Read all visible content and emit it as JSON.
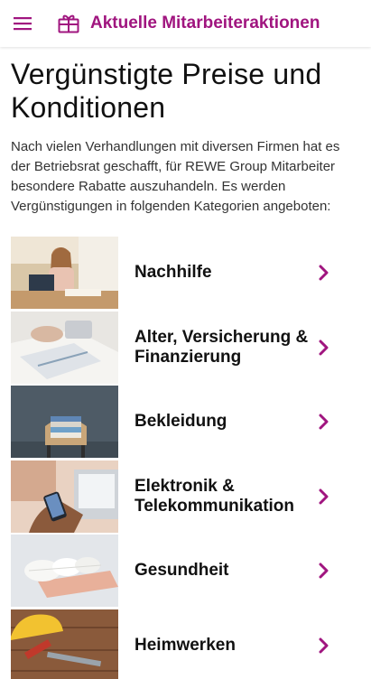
{
  "colors": {
    "accent": "#a0157f"
  },
  "appbar": {
    "menu_icon": "hamburger-menu-icon",
    "title_icon": "gift-icon",
    "title": "Aktuelle Mitarbeiteraktionen"
  },
  "page": {
    "title": "Vergünstigte Preise und Konditionen",
    "intro": "Nach vielen Verhandlungen mit diversen Firmen hat es der Betriebsrat geschafft, für REWE Group Mitarbeiter besondere Rabatte auszuhandeln. Es werden Vergünstigungen in folgenden Kategorien angeboten:"
  },
  "categories": [
    {
      "label": "Nachhilfe",
      "image": "girl-studying-with-tablet"
    },
    {
      "label": "Alter, Versicherung & Finanzierung",
      "image": "documents-and-calculator"
    },
    {
      "label": "Bekleidung",
      "image": "stacked-clothes-on-chair"
    },
    {
      "label": "Elektronik & Telekommunikation",
      "image": "hands-with-smartphone-and-laptop"
    },
    {
      "label": "Gesundheit",
      "image": "bandage-rolls"
    },
    {
      "label": "Heimwerken",
      "image": "hard-hat-and-tools-on-wood"
    }
  ]
}
